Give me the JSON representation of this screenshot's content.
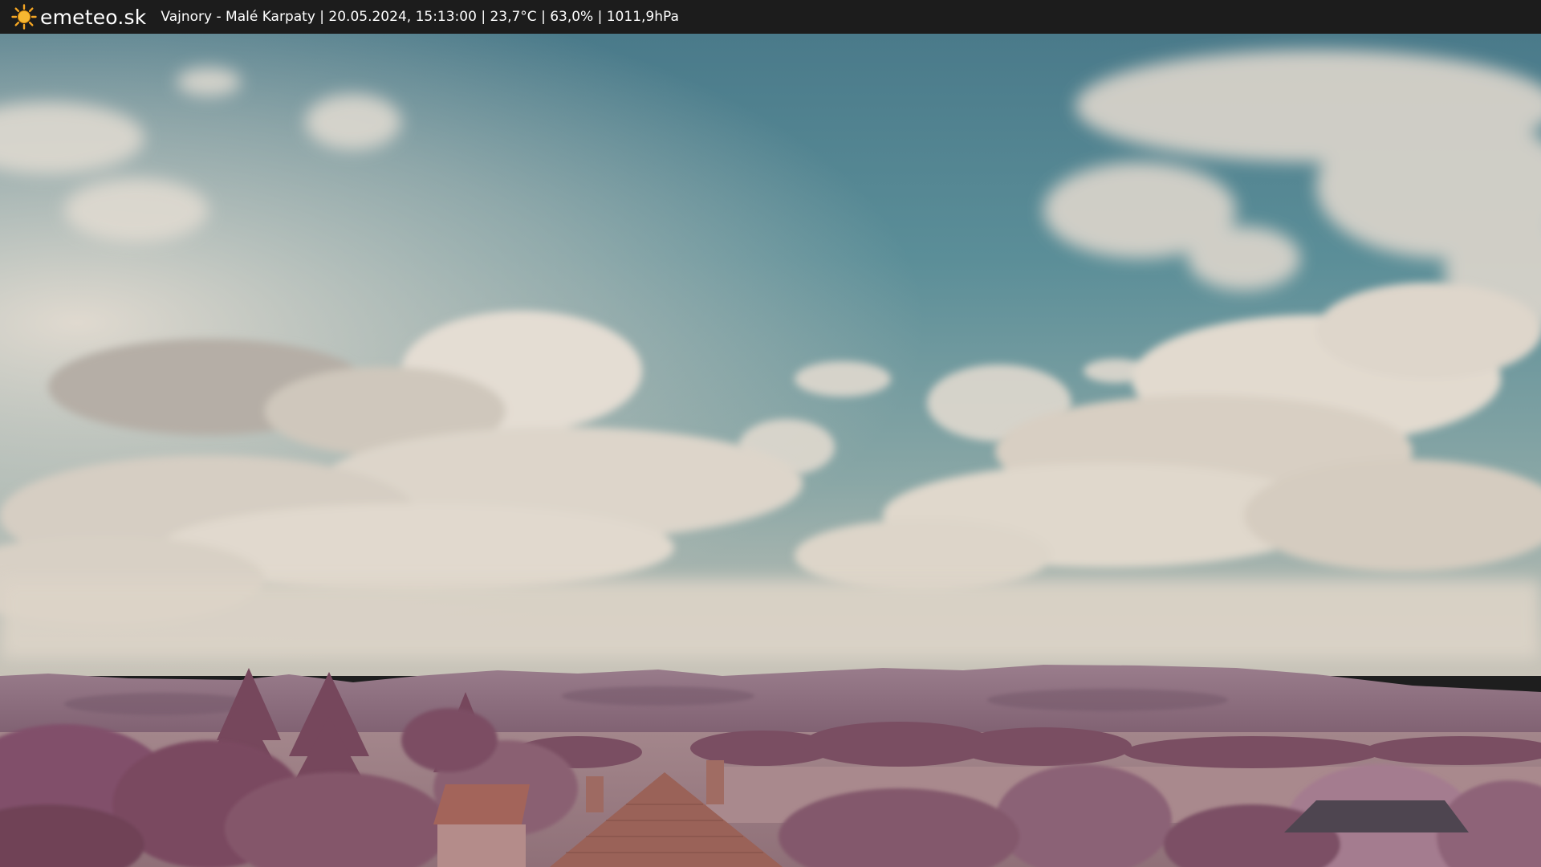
{
  "header": {
    "brand": "emeteo.sk",
    "logo_icon": "sun-icon",
    "caption": "Vajnory - Malé Karpaty | 20.05.2024, 15:13:00 | 23,7°C | 63,0% | 1011,9hPa"
  },
  "colors": {
    "bar_background": "#1c1c1c",
    "sun_color": "#f5a623",
    "sky_top": "#4f7f8e",
    "hills": "#8e6f80",
    "foliage": "#8a5a6e"
  }
}
